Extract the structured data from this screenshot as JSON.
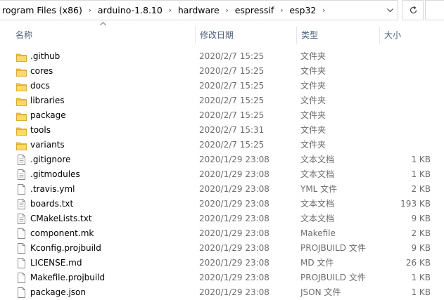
{
  "address": {
    "crumbs": [
      "rogram Files (x86)",
      "arduino-1.8.10",
      "hardware",
      "espressif",
      "esp32"
    ]
  },
  "header": {
    "name": "名称",
    "date": "修改日期",
    "type": "类型",
    "size": "大小"
  },
  "rows": [
    {
      "name": ".github",
      "date": "2020/2/7 15:25",
      "type": "文件夹",
      "size": "",
      "kind": "folder"
    },
    {
      "name": "cores",
      "date": "2020/2/7 15:25",
      "type": "文件夹",
      "size": "",
      "kind": "folder"
    },
    {
      "name": "docs",
      "date": "2020/2/7 15:25",
      "type": "文件夹",
      "size": "",
      "kind": "folder"
    },
    {
      "name": "libraries",
      "date": "2020/2/7 15:25",
      "type": "文件夹",
      "size": "",
      "kind": "folder"
    },
    {
      "name": "package",
      "date": "2020/2/7 15:25",
      "type": "文件夹",
      "size": "",
      "kind": "folder"
    },
    {
      "name": "tools",
      "date": "2020/2/7 15:31",
      "type": "文件夹",
      "size": "",
      "kind": "folder"
    },
    {
      "name": "variants",
      "date": "2020/2/7 15:25",
      "type": "文件夹",
      "size": "",
      "kind": "folder"
    },
    {
      "name": ".gitignore",
      "date": "2020/1/29 23:08",
      "type": "文本文档",
      "size": "1 KB",
      "kind": "text"
    },
    {
      "name": ".gitmodules",
      "date": "2020/1/29 23:08",
      "type": "文本文档",
      "size": "1 KB",
      "kind": "text"
    },
    {
      "name": ".travis.yml",
      "date": "2020/1/29 23:08",
      "type": "YML 文件",
      "size": "2 KB",
      "kind": "file"
    },
    {
      "name": "boards.txt",
      "date": "2020/1/29 23:08",
      "type": "文本文档",
      "size": "193 KB",
      "kind": "text"
    },
    {
      "name": "CMakeLists.txt",
      "date": "2020/1/29 23:08",
      "type": "文本文档",
      "size": "9 KB",
      "kind": "text"
    },
    {
      "name": "component.mk",
      "date": "2020/1/29 23:08",
      "type": "Makefile",
      "size": "2 KB",
      "kind": "file"
    },
    {
      "name": "Kconfig.projbuild",
      "date": "2020/1/29 23:08",
      "type": "PROJBUILD 文件",
      "size": "9 KB",
      "kind": "file"
    },
    {
      "name": "LICENSE.md",
      "date": "2020/1/29 23:08",
      "type": "MD 文件",
      "size": "26 KB",
      "kind": "file"
    },
    {
      "name": "Makefile.projbuild",
      "date": "2020/1/29 23:08",
      "type": "PROJBUILD 文件",
      "size": "1 KB",
      "kind": "file"
    },
    {
      "name": "package.json",
      "date": "2020/1/29 23:08",
      "type": "JSON 文件",
      "size": "1 KB",
      "kind": "file"
    }
  ],
  "icons": {
    "folder": "folder-icon",
    "text": "text-document-icon",
    "file": "file-icon",
    "refresh": "refresh-icon",
    "separator": "chevron-right-icon",
    "dropdown": "chevron-down-icon",
    "sort": "sort-ascending-icon"
  },
  "colors": {
    "folder": "#f5c443",
    "header_text": "#4c607a",
    "meta_text": "#6d6d6d"
  }
}
